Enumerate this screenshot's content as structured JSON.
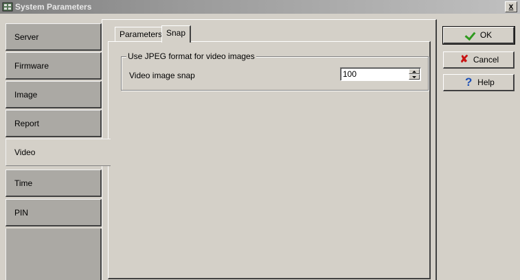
{
  "window": {
    "title": "System Parameters",
    "close_label": "x"
  },
  "sidebar": {
    "items": [
      {
        "label": "Server"
      },
      {
        "label": "Firmware"
      },
      {
        "label": "Image"
      },
      {
        "label": "Report"
      },
      {
        "label": "Video"
      },
      {
        "label": "Time"
      },
      {
        "label": "PIN"
      }
    ],
    "active": "Video"
  },
  "tabs": {
    "items": [
      {
        "label": "Parameters"
      },
      {
        "label": "Snap"
      }
    ],
    "active": "Snap"
  },
  "snap": {
    "group_label": "Use JPEG format for video images",
    "field_label": "Video image snap",
    "field_value": "100"
  },
  "buttons": {
    "ok": "OK",
    "cancel": "Cancel",
    "help": "Help"
  },
  "icons": {
    "app": "settings-grid-icon",
    "ok": "green-check-icon",
    "cancel": "red-x-icon",
    "help": "blue-question-icon"
  },
  "colors": {
    "face": "#d4d0c8",
    "inactive_tab": "#aba9a4",
    "ok_check": "#2e9a1e",
    "cancel_x": "#c81414",
    "help_q": "#1b4fb8"
  }
}
